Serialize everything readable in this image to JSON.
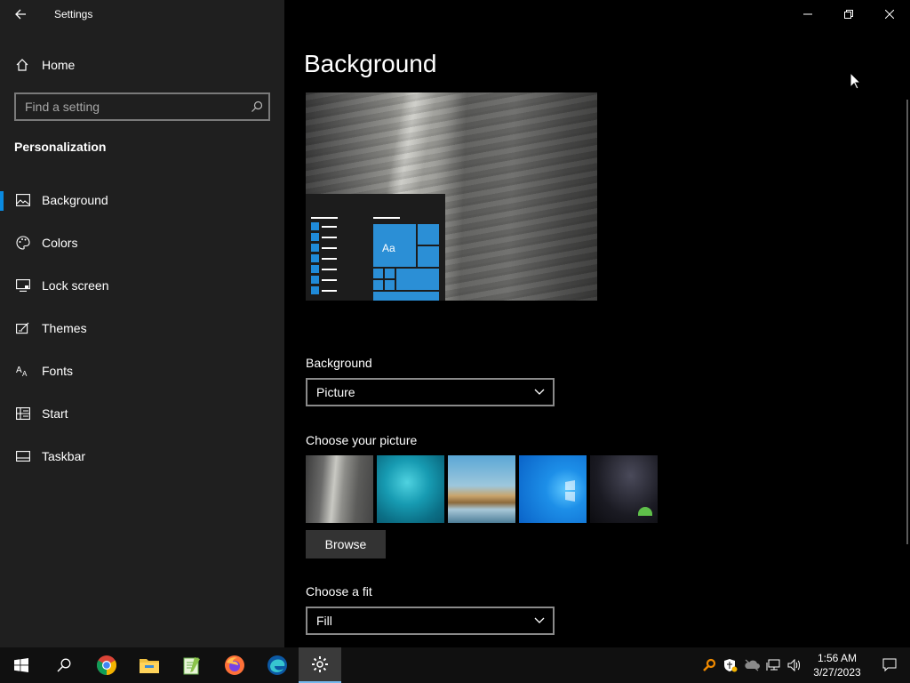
{
  "window": {
    "title": "Settings"
  },
  "sidebar": {
    "home_label": "Home",
    "search_placeholder": "Find a setting",
    "section_heading": "Personalization",
    "items": [
      {
        "label": "Background",
        "icon": "picture-icon",
        "active": true
      },
      {
        "label": "Colors",
        "icon": "palette-icon"
      },
      {
        "label": "Lock screen",
        "icon": "lock-screen-icon"
      },
      {
        "label": "Themes",
        "icon": "themes-icon"
      },
      {
        "label": "Fonts",
        "icon": "fonts-icon"
      },
      {
        "label": "Start",
        "icon": "start-icon"
      },
      {
        "label": "Taskbar",
        "icon": "taskbar-icon"
      }
    ]
  },
  "main": {
    "title": "Background",
    "preview_tile_text": "Aa",
    "background_label": "Background",
    "background_value": "Picture",
    "choose_picture_label": "Choose your picture",
    "browse_label": "Browse",
    "choose_fit_label": "Choose a fit",
    "fit_value": "Fill"
  },
  "taskbar": {
    "time": "1:56 AM",
    "date": "3/27/2023",
    "accent_color": "#76b9ed"
  },
  "colors": {
    "accent": "#0a8ae0",
    "sidebar_bg": "#1f1f1f",
    "main_bg": "#000000"
  }
}
